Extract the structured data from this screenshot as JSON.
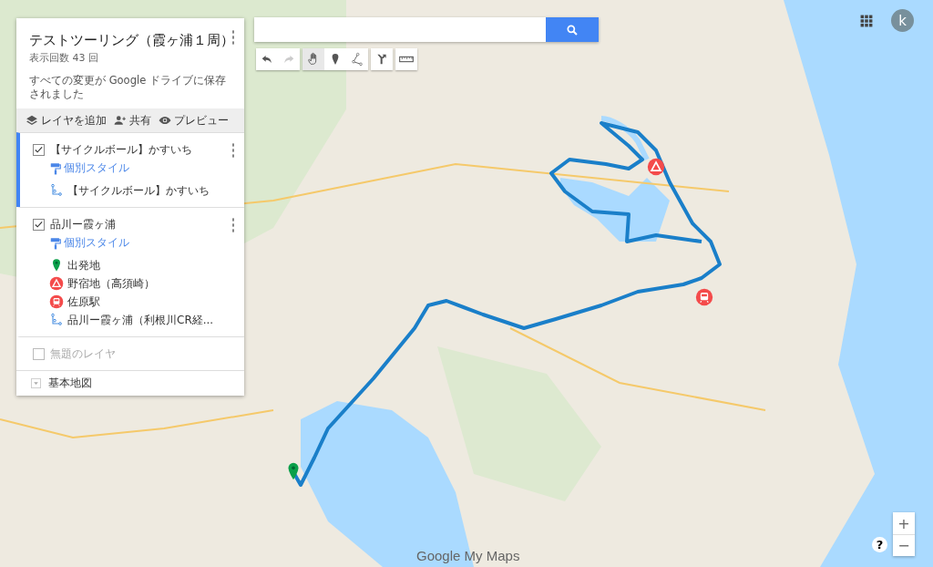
{
  "panel": {
    "title": "テストツーリング（霞ヶ浦１周）",
    "view_count": "表示回数 43 回",
    "save_status": "すべての変更が Google ドライブに保存されました",
    "actions": [
      {
        "kind": "add-layer",
        "label": "レイヤを追加"
      },
      {
        "kind": "share",
        "label": "共有"
      },
      {
        "kind": "preview",
        "label": "プレビュー"
      }
    ],
    "layers": [
      {
        "name": "【サイクルボール】かすいち",
        "checked": true,
        "selected": true,
        "disabled": false,
        "style_label": "個別スタイル",
        "items": [
          {
            "kind": "route",
            "label": "【サイクルボール】かすいち"
          }
        ]
      },
      {
        "name": "品川ー霞ヶ浦",
        "checked": true,
        "selected": false,
        "disabled": false,
        "style_label": "個別スタイル",
        "items": [
          {
            "kind": "pin",
            "label": "出発地"
          },
          {
            "kind": "camp",
            "label": "野宿地（高須崎）"
          },
          {
            "kind": "station",
            "label": "佐原駅"
          },
          {
            "kind": "route",
            "label": "品川ー霞ヶ浦（利根川CR経..."
          }
        ]
      },
      {
        "name": "無題のレイヤ",
        "checked": false,
        "selected": false,
        "disabled": true
      }
    ],
    "base_map": "基本地図"
  },
  "toolbar": [
    {
      "kind": "undo",
      "selected": false,
      "disabled": false
    },
    {
      "kind": "redo",
      "selected": false,
      "disabled": true
    },
    {
      "kind": "hand",
      "selected": true,
      "disabled": false
    },
    {
      "kind": "marker",
      "selected": false,
      "disabled": false
    },
    {
      "kind": "line",
      "selected": false,
      "disabled": false
    },
    {
      "kind": "directions",
      "selected": false,
      "disabled": false
    },
    {
      "kind": "ruler",
      "selected": false,
      "disabled": false
    }
  ],
  "account": {
    "avatar": "k"
  },
  "map": {
    "markers": [
      {
        "kind": "pin"
      },
      {
        "kind": "camp"
      },
      {
        "kind": "station"
      }
    ]
  },
  "logo": "Google My Maps",
  "zoom": {
    "in": "+",
    "out": "−"
  },
  "help": "?"
}
